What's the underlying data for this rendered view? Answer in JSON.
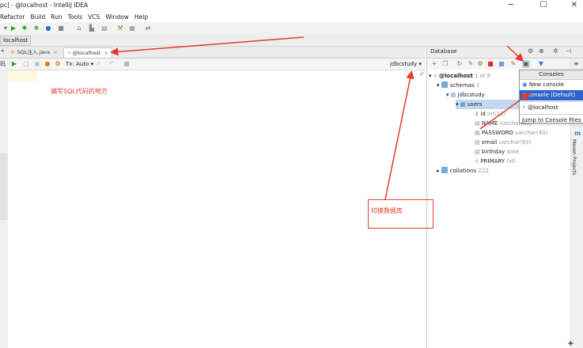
{
  "window": {
    "title": "pc] - @localhost - IntelliJ IDEA"
  },
  "menu": [
    "Refactor",
    "Build",
    "Run",
    "Tools",
    "VCS",
    "Window",
    "Help"
  ],
  "navbar": {
    "crumb": "localhost"
  },
  "editor_tabs": [
    {
      "label": "SQL注入.java"
    },
    {
      "label": "@localhost"
    }
  ],
  "editor_toolbar": {
    "tx": "Tx: Auto",
    "schema": "jdbcstudy"
  },
  "left_strip": {
    "label": "码"
  },
  "database_panel": {
    "title": "Database",
    "tree": {
      "root": {
        "label": "@localhost",
        "meta": "1 of 8"
      },
      "schemas": {
        "label": "schemas",
        "meta": "1"
      },
      "schema": {
        "label": "jdbcstudy"
      },
      "table": {
        "label": "users"
      },
      "columns": [
        {
          "name": "id",
          "type": "int(11)"
        },
        {
          "name": "NAME",
          "type": "varchar(40)"
        },
        {
          "name": "PASSWORD",
          "type": "varchar(40)"
        },
        {
          "name": "email",
          "type": "varchar(60)"
        },
        {
          "name": "birthday",
          "type": "date"
        },
        {
          "name": "PRIMARY",
          "type": "(id)"
        }
      ],
      "collations": {
        "label": "collations",
        "meta": "222"
      }
    }
  },
  "consoles_popup": {
    "header": "Consoles",
    "items": [
      "New console",
      "console (Default)",
      "@localhost",
      "Jump to Console Files"
    ]
  },
  "right_strip": {
    "tab": "Maven Projects"
  },
  "annotations": {
    "editor_note": "编写SQL代码的地方",
    "switch_db": "切换数据库"
  },
  "colors": {
    "annotation_red": "#e53b2c",
    "selection_blue": "#2f65ca"
  }
}
